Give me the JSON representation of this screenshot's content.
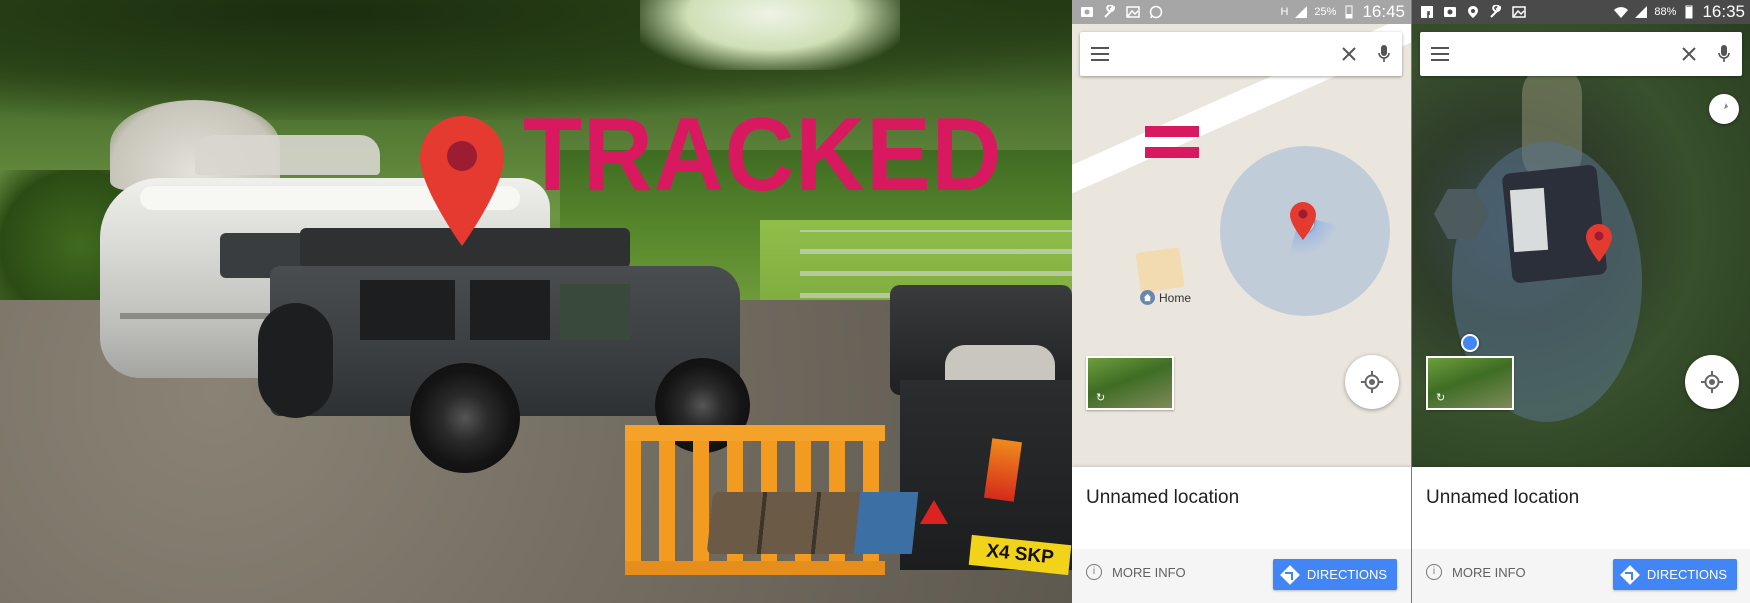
{
  "overlay": {
    "headline": "TRACKED",
    "accent_color": "#d9195f",
    "pin_color": "#e53a30",
    "plate_text": "X4 SKP"
  },
  "phones": [
    {
      "status": {
        "battery": "25%",
        "time": "16:45"
      },
      "search": {
        "value": "",
        "menu_icon": "hamburger-menu-icon",
        "clear_icon": "close-icon",
        "mic_icon": "microphone-icon"
      },
      "map": {
        "place_label": "Home"
      },
      "card": {
        "title": "Unnamed location",
        "more_info": "MORE INFO",
        "directions": "DIRECTIONS"
      }
    },
    {
      "status": {
        "battery": "88%",
        "time": "16:35"
      },
      "search": {
        "value": "",
        "menu_icon": "hamburger-menu-icon",
        "clear_icon": "close-icon",
        "mic_icon": "microphone-icon"
      },
      "map": {},
      "card": {
        "title": "Unnamed location",
        "more_info": "MORE INFO",
        "directions": "DIRECTIONS"
      }
    }
  ],
  "colors": {
    "directions_blue": "#4285f4",
    "status_grey": "#a6a6a6",
    "status_dark": "#4a4a4a"
  }
}
